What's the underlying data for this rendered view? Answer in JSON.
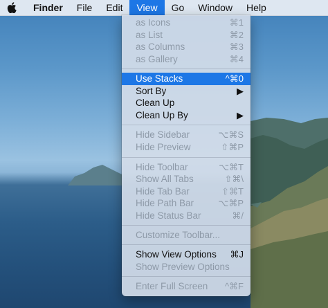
{
  "menubar": {
    "app_name": "Finder",
    "items": [
      "File",
      "Edit",
      "View",
      "Go",
      "Window",
      "Help"
    ]
  },
  "view_menu": {
    "items": [
      {
        "label": "as Icons",
        "shortcut": "⌘1",
        "state": "disabled"
      },
      {
        "label": "as List",
        "shortcut": "⌘2",
        "state": "disabled"
      },
      {
        "label": "as Columns",
        "shortcut": "⌘3",
        "state": "disabled"
      },
      {
        "label": "as Gallery",
        "shortcut": "⌘4",
        "state": "disabled"
      },
      {
        "label": "Use Stacks",
        "shortcut": "^⌘0",
        "state": "selected"
      },
      {
        "label": "Sort By",
        "shortcut": "▶",
        "state": "enabled"
      },
      {
        "label": "Clean Up",
        "shortcut": "",
        "state": "enabled"
      },
      {
        "label": "Clean Up By",
        "shortcut": "▶",
        "state": "enabled"
      },
      {
        "label": "Hide Sidebar",
        "shortcut": "⌥⌘S",
        "state": "disabled"
      },
      {
        "label": "Hide Preview",
        "shortcut": "⇧⌘P",
        "state": "disabled"
      },
      {
        "label": "Hide Toolbar",
        "shortcut": "⌥⌘T",
        "state": "disabled"
      },
      {
        "label": "Show All Tabs",
        "shortcut": "⇧⌘\\",
        "state": "disabled"
      },
      {
        "label": "Hide Tab Bar",
        "shortcut": "⇧⌘T",
        "state": "disabled"
      },
      {
        "label": "Hide Path Bar",
        "shortcut": "⌥⌘P",
        "state": "disabled"
      },
      {
        "label": "Hide Status Bar",
        "shortcut": "⌘/",
        "state": "disabled"
      },
      {
        "label": "Customize Toolbar...",
        "shortcut": "",
        "state": "disabled"
      },
      {
        "label": "Show View Options",
        "shortcut": "⌘J",
        "state": "enabled"
      },
      {
        "label": "Show Preview Options",
        "shortcut": "",
        "state": "disabled"
      },
      {
        "label": "Enter Full Screen",
        "shortcut": "^⌘F",
        "state": "disabled"
      }
    ]
  }
}
